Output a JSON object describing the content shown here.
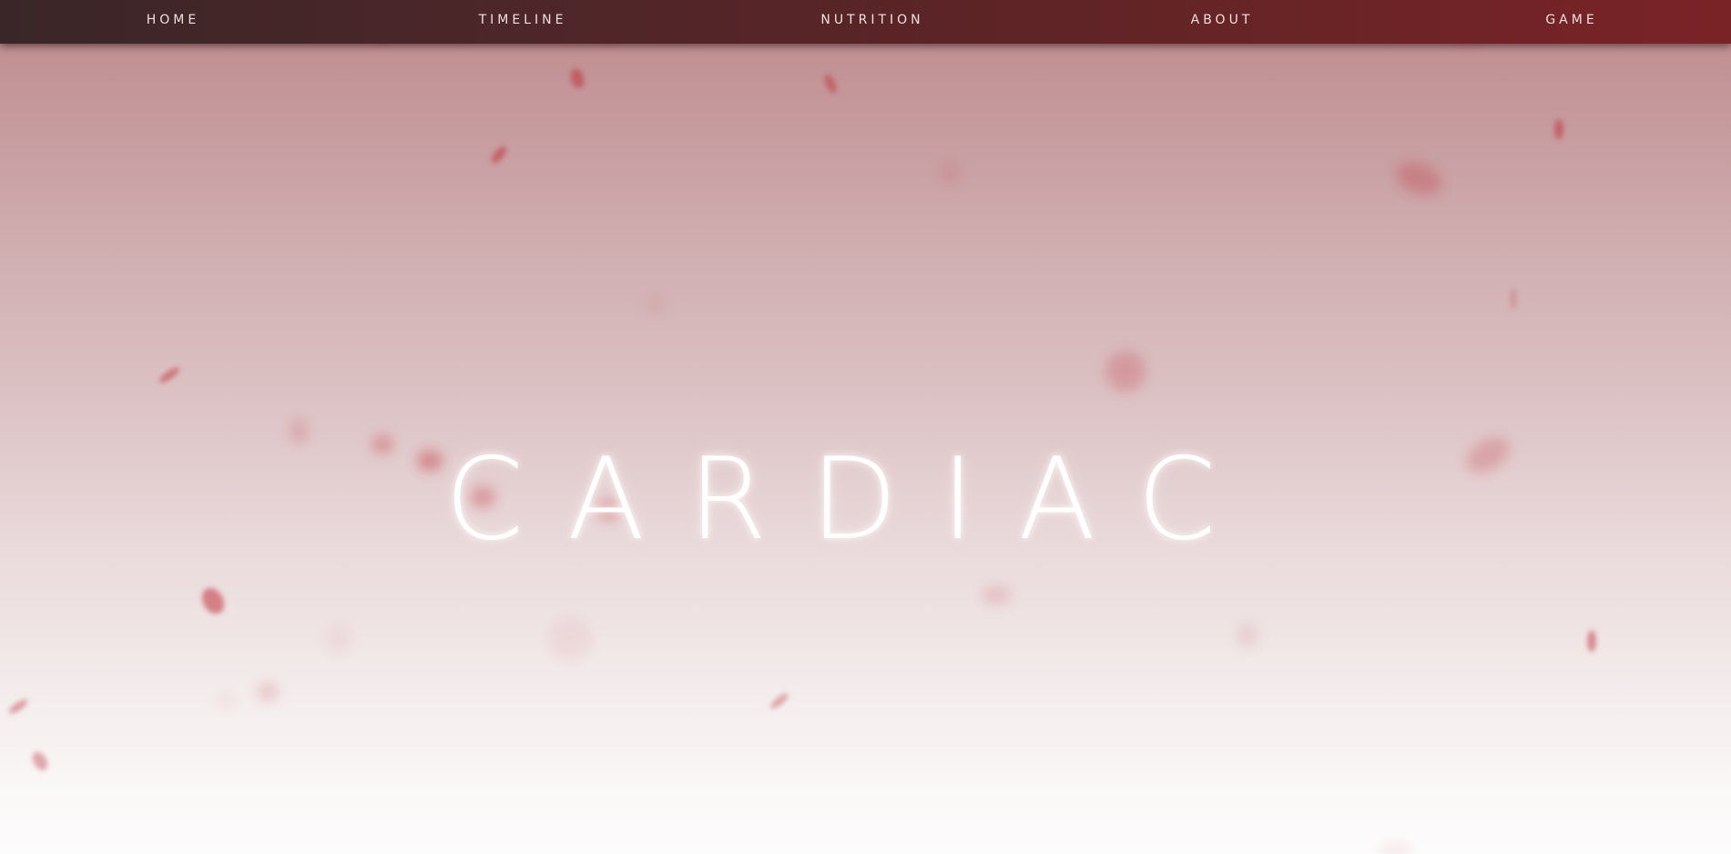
{
  "nav": {
    "items": [
      {
        "label": "HOME"
      },
      {
        "label": "TIMELINE"
      },
      {
        "label": "NUTRITION"
      },
      {
        "label": "ABOUT"
      },
      {
        "label": "GAME"
      }
    ]
  },
  "hero": {
    "title": "CARDIAC"
  },
  "colors": {
    "nav_dark": "#3a2628",
    "nav_accent": "#7a2327",
    "petal": "#c0303a",
    "text": "#ffffff"
  }
}
